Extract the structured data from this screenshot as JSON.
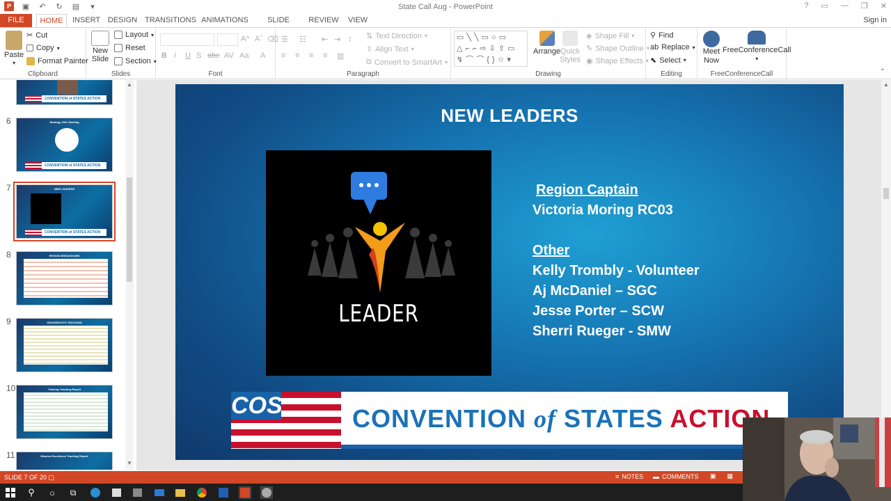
{
  "window": {
    "title": "State Call Aug - PowerPoint",
    "sign_in": "Sign in"
  },
  "tabs": [
    "FILE",
    "HOME",
    "INSERT",
    "DESIGN",
    "TRANSITIONS",
    "ANIMATIONS",
    "SLIDE SHOW",
    "REVIEW",
    "VIEW"
  ],
  "ribbon": {
    "clipboard": {
      "label": "Clipboard",
      "paste": "Paste",
      "cut": "Cut",
      "copy": "Copy",
      "format_painter": "Format Painter"
    },
    "slides": {
      "label": "Slides",
      "new_slide": "New Slide",
      "layout": "Layout",
      "reset": "Reset",
      "section": "Section"
    },
    "font": {
      "label": "Font"
    },
    "paragraph": {
      "label": "Paragraph",
      "text_direction": "Text Direction",
      "align_text": "Align Text",
      "convert_smartart": "Convert to SmartArt"
    },
    "drawing": {
      "label": "Drawing",
      "arrange": "Arrange",
      "quick_styles": "Quick Styles",
      "shape_fill": "Shape Fill",
      "shape_outline": "Shape Outline",
      "shape_effects": "Shape Effects"
    },
    "editing": {
      "label": "Editing",
      "find": "Find",
      "replace": "Replace",
      "select": "Select"
    },
    "freeconf": {
      "label": "FreeConferenceCall",
      "meet_now": "Meet Now",
      "freeconferencecall": "FreeConferenceCall"
    }
  },
  "thumbnails": [
    {
      "num": "6",
      "title": "Strategy 2021 Meeting"
    },
    {
      "num": "7",
      "title": "NEW LEADERS"
    },
    {
      "num": "8",
      "title": "REGION BREAKDOWN"
    },
    {
      "num": "9",
      "title": "GRASSROOTS TRACKING"
    },
    {
      "num": "10",
      "title": "Training Tracking Report"
    },
    {
      "num": "11",
      "title": "Mission Excellence Tracking Report"
    }
  ],
  "thumb_banner": "CONVENTION of STATES ACTION",
  "slide": {
    "title": "NEW LEADERS",
    "image_word": "LEADER",
    "region_captain_heading": "Region Captain",
    "region_captain": "Victoria Moring RC03",
    "other_heading": "Other",
    "others": [
      "Kelly Trombly - Volunteer",
      "Aj McDaniel – SGC",
      "Jesse Porter – SCW",
      "Sherri Rueger - SMW"
    ],
    "banner": {
      "logo": "COS",
      "convention": "CONVENTION",
      "of": "of",
      "states": "STATES",
      "action": "ACTION"
    }
  },
  "status": {
    "slide_of": "SLIDE 7 OF 20",
    "notes": "NOTES",
    "comments": "COMMENTS"
  },
  "colors": {
    "accent": "#d24726",
    "slide_blue": "#1677b4",
    "cos_red": "#c8102e",
    "cos_blue": "#1a72b8"
  }
}
